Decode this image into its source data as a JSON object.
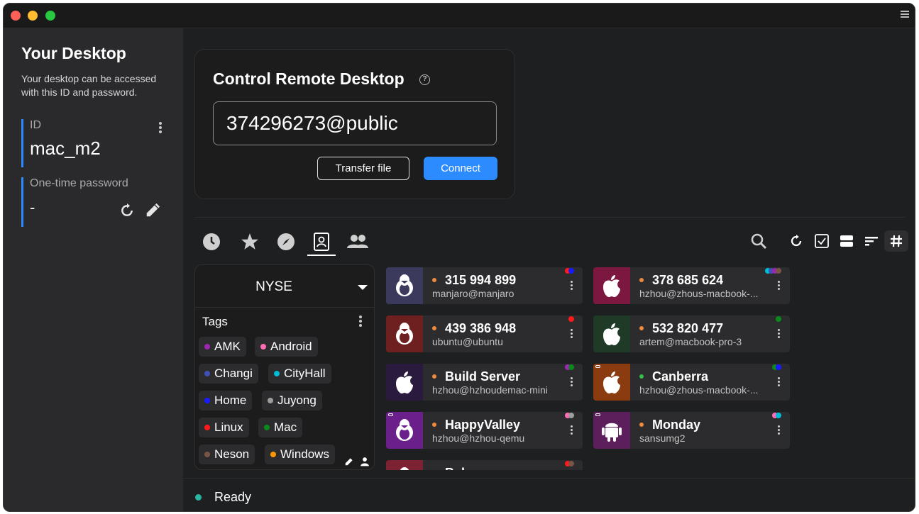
{
  "colors": {
    "accent": "#2c8cff",
    "status_ready": "#29b6a0",
    "peer_online": "#f08a3d"
  },
  "sidebar": {
    "title": "Your Desktop",
    "description": "Your desktop can be accessed with this ID and password.",
    "id_label": "ID",
    "id_value": "mac_m2",
    "password_label": "One-time password",
    "password_value": "-"
  },
  "connect": {
    "title": "Control Remote Desktop",
    "id_value": "374296273@public",
    "transfer_label": "Transfer file",
    "connect_label": "Connect"
  },
  "tabs": [
    {
      "name": "recent-sessions",
      "icon": "clock-icon"
    },
    {
      "name": "favorites",
      "icon": "star-icon"
    },
    {
      "name": "discovered",
      "icon": "compass-icon"
    },
    {
      "name": "address-book",
      "icon": "address-book-icon",
      "active": true
    },
    {
      "name": "group",
      "icon": "people-icon"
    }
  ],
  "toolbar": [
    "search-icon",
    "refresh-icon",
    "checkbox-icon",
    "view-icon",
    "sort-icon",
    "grid-icon"
  ],
  "address_book": {
    "selected": "NYSE",
    "tags_label": "Tags",
    "tags": [
      {
        "name": "AMK",
        "color": "#9c27b0"
      },
      {
        "name": "Android",
        "color": "#ff6eb4"
      },
      {
        "name": "Changi",
        "color": "#3f51b5"
      },
      {
        "name": "CityHall",
        "color": "#00bcd4"
      },
      {
        "name": "Home",
        "color": "#1a1aff"
      },
      {
        "name": "Juyong",
        "color": "#9e9e9e"
      },
      {
        "name": "Linux",
        "color": "#ff1a1a"
      },
      {
        "name": "Mac",
        "color": "#0a8a1a"
      },
      {
        "name": "Neson",
        "color": "#795548"
      },
      {
        "name": "Windows",
        "color": "#ff9800"
      }
    ]
  },
  "peers": [
    {
      "id": "315 994 899",
      "user": "manjaro@manjaro",
      "os": "linux",
      "bg": "#3b3a5c",
      "tags": [
        "#ff1a1a",
        "#1a1aff"
      ]
    },
    {
      "id": "378 685 624",
      "user": "hzhou@zhous-macbook-...",
      "os": "mac",
      "bg": "#7c1840",
      "tags": [
        "#00bcd4",
        "#3f51b5",
        "#9c27b0",
        "#795548"
      ]
    },
    {
      "id": "439 386 948",
      "user": "ubuntu@ubuntu",
      "os": "linux",
      "bg": "#6e1f1f",
      "tags": [
        "#ff1a1a"
      ]
    },
    {
      "id": "532 820 477",
      "user": "artem@macbook-pro-3",
      "os": "mac",
      "bg": "#1f3b28",
      "tags": [
        "#0a8a1a"
      ]
    },
    {
      "id": "Build Server",
      "user": "hzhou@hzhoudemac-mini",
      "os": "mac",
      "bg": "#2a1a3d",
      "tags": [
        "#9c27b0",
        "#0a8a1a"
      ]
    },
    {
      "id": "Canberra",
      "user": "hzhou@zhous-macbook-...",
      "os": "mac",
      "bg": "#8a3c10",
      "tags": [
        "#0a8a1a",
        "#1a1aff"
      ],
      "online": "green",
      "key": true
    },
    {
      "id": "HappyValley",
      "user": "hzhou@hzhou-qemu",
      "os": "linux",
      "bg": "#6a1f8a",
      "tags": [
        "#ff6eb4",
        "#9e9e9e"
      ],
      "key": true
    },
    {
      "id": "Monday",
      "user": "sansumg2",
      "os": "android",
      "bg": "#5c1f5c",
      "tags": [
        "#ff6eb4",
        "#00bcd4"
      ],
      "key": true
    },
    {
      "id": "Bah",
      "user": "",
      "os": "linux",
      "bg": "#7c2232",
      "tags": [
        "#ff1a1a",
        "#795548"
      ]
    }
  ],
  "status": {
    "text": "Ready"
  }
}
